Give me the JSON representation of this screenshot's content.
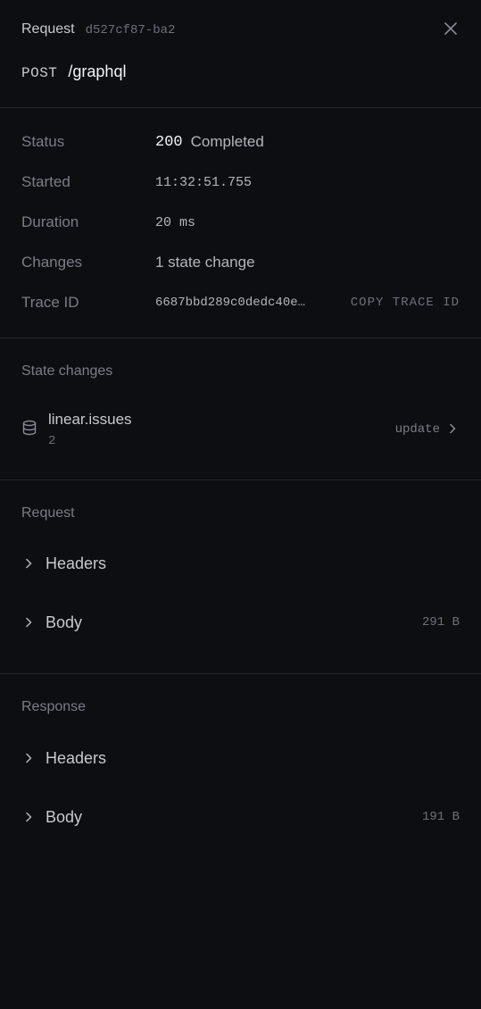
{
  "header": {
    "label": "Request",
    "request_id": "d527cf87-ba2",
    "method": "POST",
    "path": "/graphql"
  },
  "meta": {
    "status": {
      "key": "Status",
      "code": "200",
      "text": "Completed"
    },
    "started": {
      "key": "Started",
      "value": "11:32:51.755"
    },
    "duration": {
      "key": "Duration",
      "value": "20 ms"
    },
    "changes": {
      "key": "Changes",
      "value": "1 state change"
    },
    "trace": {
      "key": "Trace ID",
      "value": "6687bbd289c0dedc40e…",
      "copy_label": "COPY TRACE ID"
    }
  },
  "state_changes": {
    "title": "State changes",
    "items": [
      {
        "name": "linear.issues",
        "count": "2",
        "action": "update"
      }
    ]
  },
  "request": {
    "title": "Request",
    "headers_label": "Headers",
    "body_label": "Body",
    "body_size": "291 B"
  },
  "response": {
    "title": "Response",
    "headers_label": "Headers",
    "body_label": "Body",
    "body_size": "191 B"
  },
  "icons": {
    "close": "close-icon",
    "database": "database-icon",
    "chevron": "chevron-right-icon"
  },
  "colors": {
    "background": "#0d0e12",
    "divider": "#26272d",
    "muted": "#7b7d86",
    "text": "#c8c9cf"
  }
}
